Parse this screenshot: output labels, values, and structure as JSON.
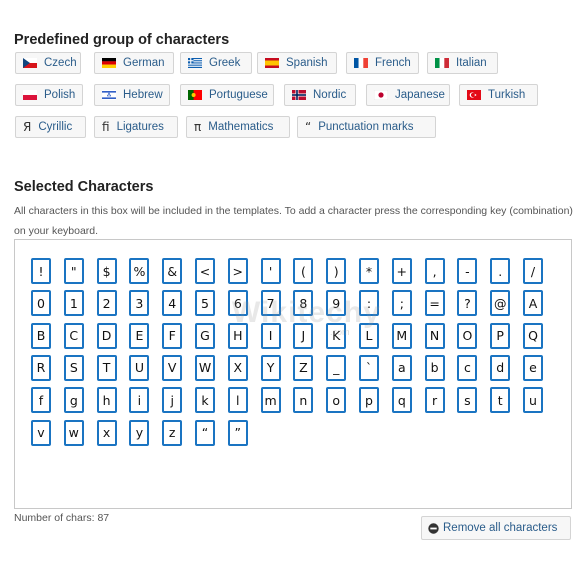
{
  "predefined": {
    "title": "Predefined group of characters",
    "groups": [
      {
        "label": "Czech",
        "icon": "czech-flag-icon"
      },
      {
        "label": "German",
        "icon": "german-flag-icon"
      },
      {
        "label": "Greek",
        "icon": "greek-flag-icon"
      },
      {
        "label": "Spanish",
        "icon": "spanish-flag-icon"
      },
      {
        "label": "French",
        "icon": "french-flag-icon"
      },
      {
        "label": "Italian",
        "icon": "italian-flag-icon"
      },
      {
        "label": "Polish",
        "icon": "polish-flag-icon"
      },
      {
        "label": "Hebrew",
        "icon": "hebrew-flag-icon"
      },
      {
        "label": "Portuguese",
        "icon": "portuguese-flag-icon"
      },
      {
        "label": "Nordic",
        "icon": "nordic-flag-icon"
      },
      {
        "label": "Japanese",
        "icon": "japanese-flag-icon"
      },
      {
        "label": "Turkish",
        "icon": "turkish-flag-icon"
      },
      {
        "label": "Cyrillic",
        "icon": "cyrillic-glyph-icon",
        "glyph": "Я"
      },
      {
        "label": "Ligatures",
        "icon": "ligature-glyph-icon",
        "glyph": "ﬁ"
      },
      {
        "label": "Mathematics",
        "icon": "pi-glyph-icon",
        "glyph": "π"
      },
      {
        "label": "Punctuation marks",
        "icon": "quote-glyph-icon",
        "glyph": "“"
      }
    ]
  },
  "selected": {
    "title": "Selected Characters",
    "description": "All characters in this box will be included in the templates. To add a character press the corresponding key (combination) on your keyboard.",
    "characters": [
      "!",
      "\"",
      "$",
      "%",
      "&",
      "<",
      ">",
      "'",
      "(",
      ")",
      "*",
      "+",
      ",",
      "-",
      ".",
      "/",
      "0",
      "1",
      "2",
      "3",
      "4",
      "5",
      "6",
      "7",
      "8",
      "9",
      ":",
      ";",
      "=",
      "?",
      "@",
      "A",
      "B",
      "C",
      "D",
      "E",
      "F",
      "G",
      "H",
      "I",
      "J",
      "K",
      "L",
      "M",
      "N",
      "O",
      "P",
      "Q",
      "R",
      "S",
      "T",
      "U",
      "V",
      "W",
      "X",
      "Y",
      "Z",
      "_",
      "`",
      "a",
      "b",
      "c",
      "d",
      "e",
      "f",
      "g",
      "h",
      "i",
      "j",
      "k",
      "l",
      "m",
      "n",
      "o",
      "p",
      "q",
      "r",
      "s",
      "t",
      "u",
      "v",
      "w",
      "x",
      "y",
      "z",
      "“",
      "”"
    ],
    "count_text": "Number of chars: 87",
    "remove_label": "Remove all characters",
    "remove_icon": "no-entry-icon"
  },
  "watermark": {
    "main": "Wikitechy",
    "sub": ".com"
  }
}
